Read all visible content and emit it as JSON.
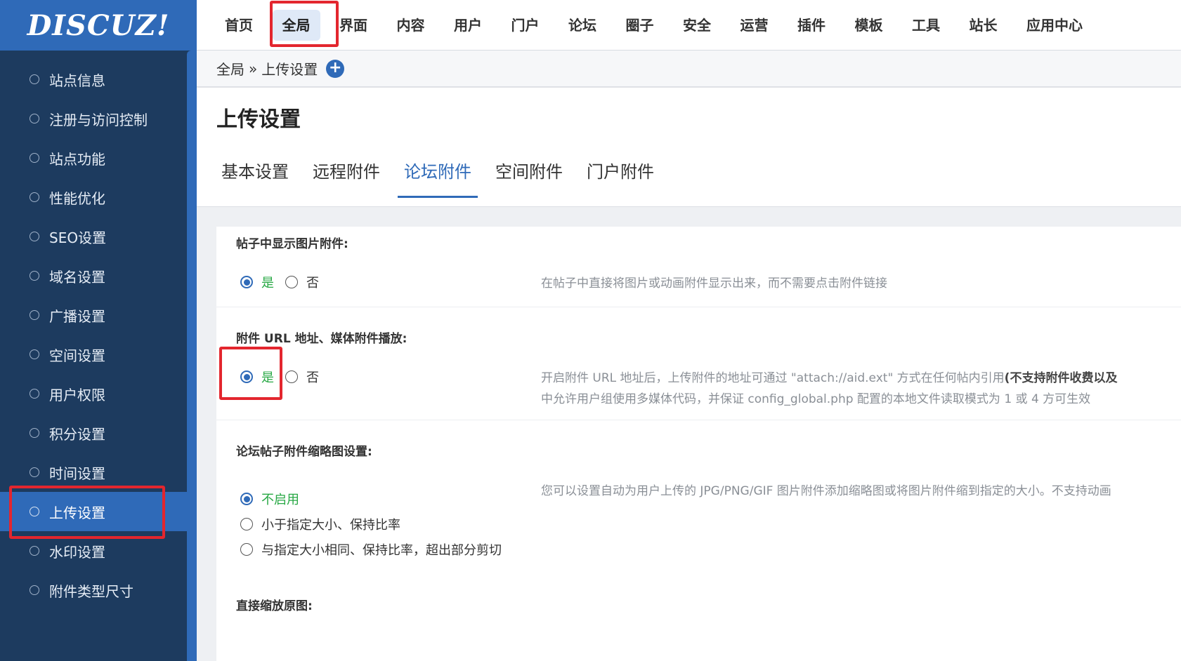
{
  "logo": {
    "text": "DISCUZ!"
  },
  "topnav": {
    "items": [
      "首页",
      "全局",
      "界面",
      "内容",
      "用户",
      "门户",
      "论坛",
      "圈子",
      "安全",
      "运营",
      "插件",
      "模板",
      "工具",
      "站长",
      "应用中心"
    ],
    "active_index": 1
  },
  "breadcrumb": {
    "parent": "全局",
    "separator": "»",
    "current": "上传设置",
    "add_icon": "+"
  },
  "page": {
    "title": "上传设置",
    "tabs": [
      "基本设置",
      "远程附件",
      "论坛附件",
      "空间附件",
      "门户附件"
    ],
    "active_tab": 2
  },
  "sidebar": {
    "items": [
      "站点信息",
      "注册与访问控制",
      "站点功能",
      "性能优化",
      "SEO设置",
      "域名设置",
      "广播设置",
      "空间设置",
      "用户权限",
      "积分设置",
      "时间设置",
      "上传设置",
      "水印设置",
      "附件类型尺寸"
    ],
    "active_index": 11
  },
  "settings": {
    "show_image": {
      "title": "帖子中显示图片附件:",
      "yes": "是",
      "no": "否",
      "value": "yes",
      "desc": "在帖子中直接将图片或动画附件显示出来，而不需要点击附件链接"
    },
    "attach_url": {
      "title": "附件 URL 地址、媒体附件播放:",
      "yes": "是",
      "no": "否",
      "value": "yes",
      "desc_line1": "开启附件 URL 地址后，上传附件的地址可通过 \"attach://aid.ext\" 方式在任何帖内引用",
      "desc_line1_bold": "(不支持附件收费以及",
      "desc_line2": "中允许用户组使用多媒体代码，并保证 config_global.php 配置的本地文件读取模式为 1 或 4 方可生效"
    },
    "thumbnail": {
      "title": "论坛帖子附件缩略图设置:",
      "options": [
        "不启用",
        "小于指定大小、保持比率",
        "与指定大小相同、保持比率，超出部分剪切"
      ],
      "selected": 0,
      "desc": "您可以设置自动为用户上传的 JPG/PNG/GIF 图片附件添加缩略图或将图片附件缩到指定的大小。不支持动画"
    },
    "scale_original": {
      "title": "直接缩放原图:"
    }
  },
  "colors": {
    "accent": "#2f6ab8",
    "sidebar_bg": "#1d3b5f",
    "highlight": "#e3262e",
    "selected_text": "#27a844"
  }
}
